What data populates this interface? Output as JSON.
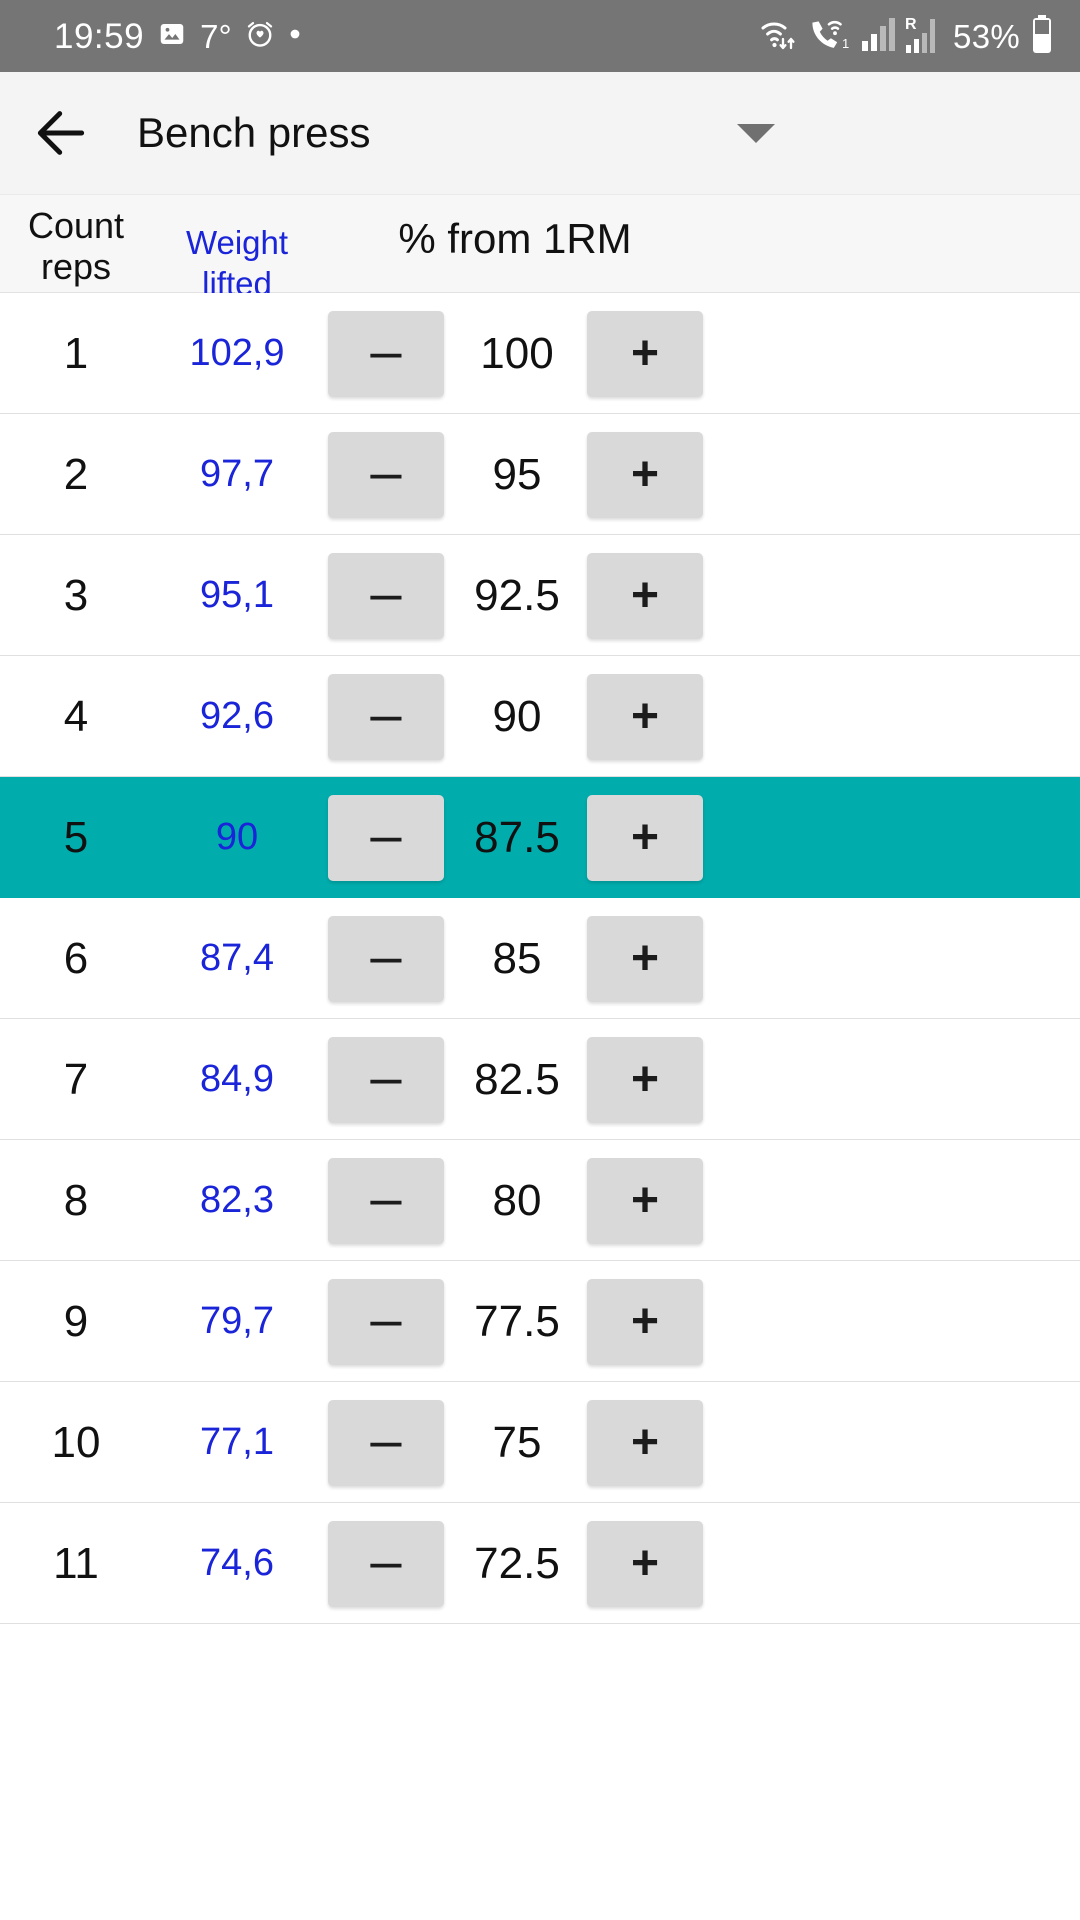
{
  "status_bar": {
    "time": "19:59",
    "temperature": "7°",
    "battery_percent": "53%",
    "icons_left": [
      "image-icon",
      "alarm-clock-icon",
      "dot-icon"
    ],
    "icons_right": [
      "wifi-transfer-icon",
      "call-signal-icon",
      "signal-bars-1-icon",
      "roaming-signal-icon",
      "battery-icon"
    ],
    "roaming_label": "R",
    "sim_label": "1",
    "background_color": "#757575"
  },
  "app_bar": {
    "back_icon": "arrow-left-icon",
    "title": "Bench press",
    "dropdown_icon": "triangle-down-icon",
    "background_color": "#f4f4f4"
  },
  "table": {
    "headers": {
      "count_line1": "Count",
      "count_line2": "reps",
      "weight": "Weight lifted",
      "percent": "% from 1RM"
    },
    "colors": {
      "weight_text": "#1a24d8",
      "highlight_row": "#00ACAC",
      "stepper_bg": "#d9d9d9"
    },
    "minus_label": "–",
    "plus_label": "+",
    "rows": [
      {
        "count": "1",
        "weight": "102,9",
        "percent": "100",
        "highlighted": false
      },
      {
        "count": "2",
        "weight": "97,7",
        "percent": "95",
        "highlighted": false
      },
      {
        "count": "3",
        "weight": "95,1",
        "percent": "92.5",
        "highlighted": false
      },
      {
        "count": "4",
        "weight": "92,6",
        "percent": "90",
        "highlighted": false
      },
      {
        "count": "5",
        "weight": "90",
        "percent": "87.5",
        "highlighted": true
      },
      {
        "count": "6",
        "weight": "87,4",
        "percent": "85",
        "highlighted": false
      },
      {
        "count": "7",
        "weight": "84,9",
        "percent": "82.5",
        "highlighted": false
      },
      {
        "count": "8",
        "weight": "82,3",
        "percent": "80",
        "highlighted": false
      },
      {
        "count": "9",
        "weight": "79,7",
        "percent": "77.5",
        "highlighted": false
      },
      {
        "count": "10",
        "weight": "77,1",
        "percent": "75",
        "highlighted": false
      },
      {
        "count": "11",
        "weight": "74,6",
        "percent": "72.5",
        "highlighted": false
      }
    ]
  }
}
